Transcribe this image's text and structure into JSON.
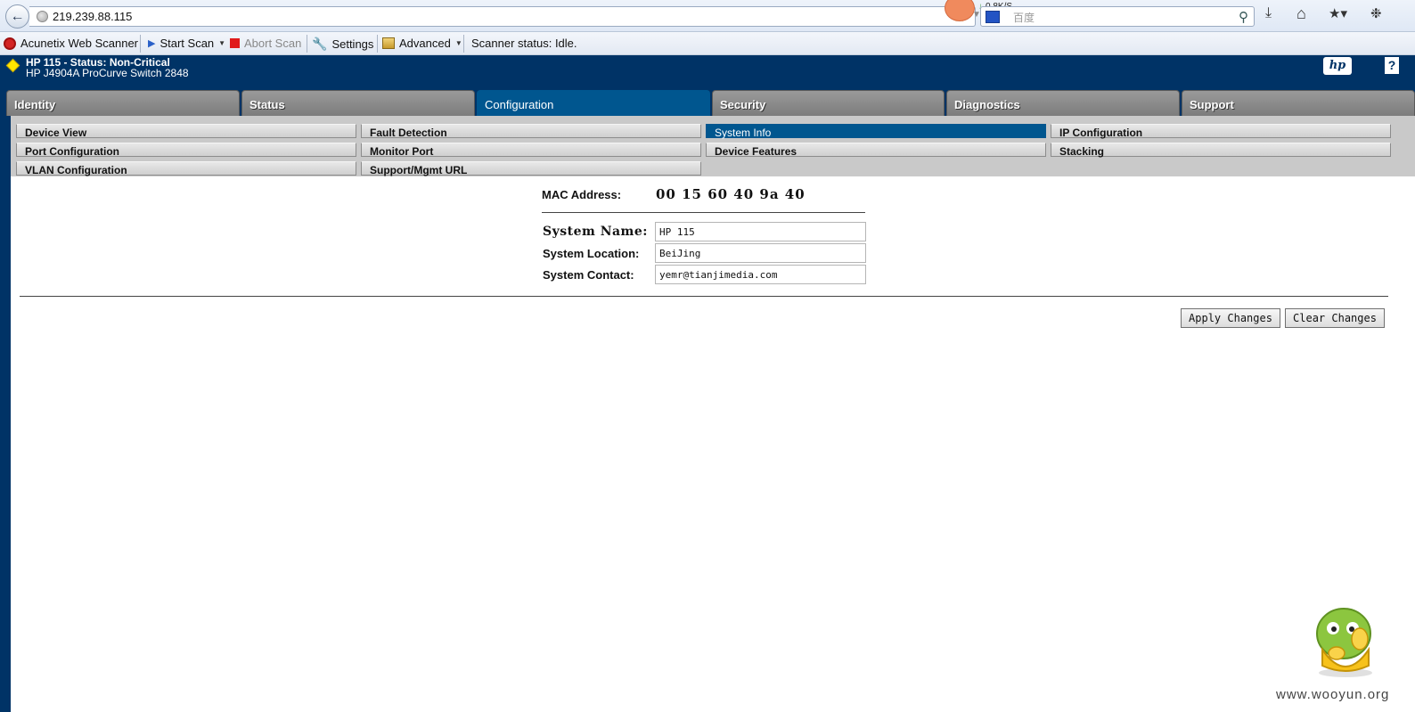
{
  "browser": {
    "url": "219.239.88.115",
    "download_speed": "0.8K/S",
    "search_placeholder": "百度"
  },
  "scanner_toolbar": {
    "app_name": "Acunetix Web Scanner",
    "start_scan": "Start Scan",
    "abort_scan": "Abort Scan",
    "settings": "Settings",
    "advanced": "Advanced",
    "status": "Scanner status: Idle."
  },
  "device": {
    "title": "HP 115 - Status: Non-Critical",
    "model": "HP J4904A ProCurve Switch 2848",
    "logo_text": "hp",
    "help_text": "?"
  },
  "tabs": [
    {
      "label": "Identity",
      "active": false
    },
    {
      "label": "Status",
      "active": false
    },
    {
      "label": "Configuration",
      "active": true
    },
    {
      "label": "Security",
      "active": false
    },
    {
      "label": "Diagnostics",
      "active": false
    },
    {
      "label": "Support",
      "active": false
    }
  ],
  "subnav": {
    "items": [
      {
        "label": "Device View",
        "active": false
      },
      {
        "label": "Fault Detection",
        "active": false
      },
      {
        "label": "System Info",
        "active": true
      },
      {
        "label": "IP Configuration",
        "active": false
      },
      {
        "label": "Port Configuration",
        "active": false
      },
      {
        "label": "Monitor Port",
        "active": false
      },
      {
        "label": "Device Features",
        "active": false
      },
      {
        "label": "Stacking",
        "active": false
      },
      {
        "label": "VLAN Configuration",
        "active": false
      },
      {
        "label": "Support/Mgmt URL",
        "active": false
      }
    ]
  },
  "system_info": {
    "mac_label": "MAC Address:",
    "mac_value": "00 15 60 40 9a 40",
    "name_label": "System Name:",
    "name_value": "HP 115",
    "location_label": "System Location:",
    "location_value": "BeiJing",
    "contact_label": "System Contact:",
    "contact_value": "yemr@tianjimedia.com",
    "apply_button": "Apply Changes",
    "clear_button": "Clear Changes"
  },
  "watermark": {
    "text": "www.wooyun.org"
  },
  "colors": {
    "hp_navy": "#003366",
    "active_tab": "#00568f",
    "inactive_tab": "#8a8a8a"
  }
}
